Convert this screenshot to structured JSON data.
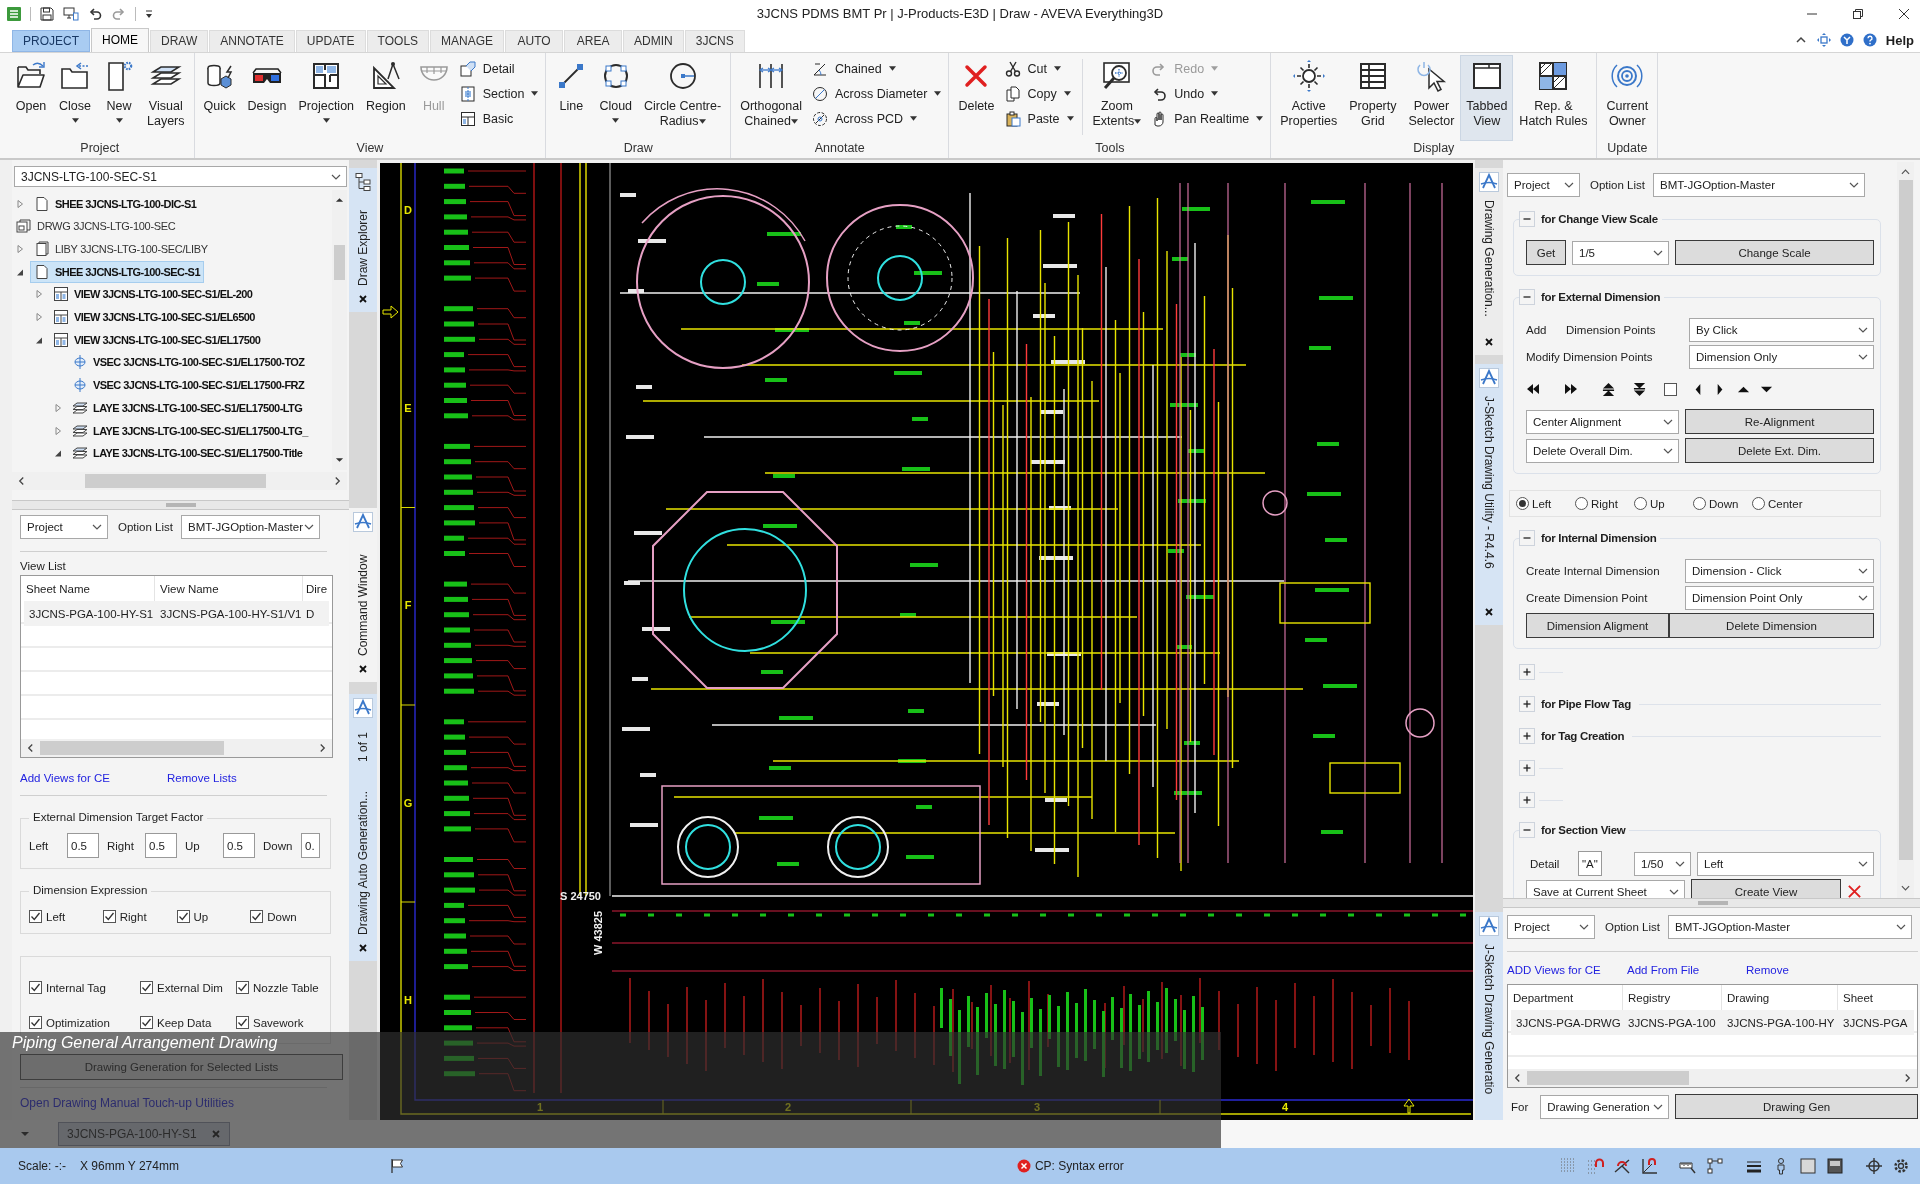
{
  "window": {
    "title": "3JCNS PDMS BMT Pr | J-Products-E3D | Draw - AVEVA Everything3D"
  },
  "ribbon_tabs": [
    {
      "label": "PROJECT",
      "kind": "backstage",
      "selected": false
    },
    {
      "label": "HOME",
      "kind": "tab",
      "selected": true
    },
    {
      "label": "DRAW",
      "kind": "tab",
      "selected": false
    },
    {
      "label": "ANNOTATE",
      "kind": "tab",
      "selected": false
    },
    {
      "label": "UPDATE",
      "kind": "tab",
      "selected": false
    },
    {
      "label": "TOOLS",
      "kind": "tab",
      "selected": false
    },
    {
      "label": "MANAGE",
      "kind": "tab",
      "selected": false
    },
    {
      "label": "AUTO",
      "kind": "tab",
      "selected": false
    },
    {
      "label": "AREA",
      "kind": "tab",
      "selected": false
    },
    {
      "label": "ADMIN",
      "kind": "tab",
      "selected": false
    },
    {
      "label": "3JCNS",
      "kind": "tab",
      "selected": false
    }
  ],
  "help": "Help",
  "ribbon_groups": [
    {
      "label": "Project",
      "items": [
        {
          "kind": "large",
          "label": "Open",
          "dropdown": false
        },
        {
          "kind": "large",
          "label": "Close",
          "dropdown": true
        },
        {
          "kind": "large",
          "label": "New",
          "dropdown": true
        },
        {
          "kind": "large",
          "label": "Visual\nLayers",
          "dropdown": false
        }
      ]
    },
    {
      "label": "View",
      "items": [
        {
          "kind": "large",
          "label": "Quick",
          "dropdown": false,
          "disabled": false
        },
        {
          "kind": "large",
          "label": "Design",
          "dropdown": false,
          "disabled": false
        },
        {
          "kind": "large",
          "label": "Projection",
          "dropdown": true,
          "disabled": false
        },
        {
          "kind": "large",
          "label": "Region",
          "dropdown": false,
          "disabled": false
        },
        {
          "kind": "large",
          "label": "Hull",
          "dropdown": false,
          "disabled": true
        },
        {
          "kind": "stack",
          "items": [
            {
              "label": "Detail",
              "dropdown": false,
              "disabled": false
            },
            {
              "label": "Section",
              "dropdown": true,
              "disabled": false
            },
            {
              "label": "Basic",
              "dropdown": false,
              "disabled": false
            }
          ]
        }
      ]
    },
    {
      "label": "Draw",
      "items": [
        {
          "kind": "large",
          "label": "Line",
          "dropdown": false
        },
        {
          "kind": "large",
          "label": "Cloud",
          "dropdown": true
        },
        {
          "kind": "large",
          "label": "Circle Centre-\nRadius",
          "dropdown": true
        }
      ]
    },
    {
      "label": "Annotate",
      "items": [
        {
          "kind": "large",
          "label": "Orthogonal\nChained",
          "dropdown": true
        },
        {
          "kind": "stack",
          "items": [
            {
              "label": "Chained",
              "dropdown": true
            },
            {
              "label": "Across Diameter",
              "dropdown": true
            },
            {
              "label": "Across PCD",
              "dropdown": true
            }
          ]
        }
      ]
    },
    {
      "label": "Tools",
      "items": [
        {
          "kind": "large",
          "label": "Delete",
          "dropdown": false,
          "disabled": false
        },
        {
          "kind": "stack",
          "items": [
            {
              "label": "Cut",
              "dropdown": true,
              "disabled": false
            },
            {
              "label": "Copy",
              "dropdown": true,
              "disabled": false
            },
            {
              "label": "Paste",
              "dropdown": true,
              "disabled": false
            }
          ]
        },
        {
          "kind": "divider"
        },
        {
          "kind": "large",
          "label": "Zoom\nExtents",
          "dropdown": true,
          "disabled": false
        },
        {
          "kind": "stack",
          "items": [
            {
              "label": "Redo",
              "dropdown": true,
              "disabled": true
            },
            {
              "label": "Undo",
              "dropdown": true,
              "disabled": false
            },
            {
              "label": "Pan Realtime",
              "dropdown": true,
              "disabled": false
            }
          ]
        }
      ]
    },
    {
      "label": "Display",
      "items": [
        {
          "kind": "large",
          "label": "Active\nProperties",
          "dropdown": false,
          "on": false
        },
        {
          "kind": "large",
          "label": "Property\nGrid",
          "dropdown": false,
          "on": false
        },
        {
          "kind": "large",
          "label": "Power\nSelector",
          "dropdown": false,
          "on": false
        },
        {
          "kind": "large",
          "label": "Tabbed\nView",
          "dropdown": false,
          "on": true
        },
        {
          "kind": "large",
          "label": "Rep. &\nHatch Rules",
          "dropdown": false,
          "on": false
        }
      ]
    },
    {
      "label": "Update",
      "items": [
        {
          "kind": "large",
          "label": "Current\nOwner",
          "dropdown": false
        }
      ]
    }
  ],
  "explorer": {
    "selector": "3JCNS-LTG-100-SEC-S1",
    "tree": [
      {
        "kind": "shee",
        "label": "SHEE 3JCNS-LTG-100-DIC-S1",
        "expanded": false,
        "selected": false
      },
      {
        "kind": "drwg",
        "label": "DRWG 3JCNS-LTG-100-SEC",
        "selected": false,
        "children": [
          {
            "kind": "liby",
            "label": "LIBY 3JCNS-LTG-100-SEC/LIBY",
            "expanded": false,
            "selected": false
          },
          {
            "kind": "shee",
            "label": "SHEE 3JCNS-LTG-100-SEC-S1",
            "expanded": true,
            "selected": true,
            "children": [
              {
                "kind": "view",
                "label": "VIEW 3JCNS-LTG-100-SEC-S1/EL-200",
                "expanded": false,
                "selected": false
              },
              {
                "kind": "view",
                "label": "VIEW 3JCNS-LTG-100-SEC-S1/EL6500",
                "expanded": false,
                "selected": false
              },
              {
                "kind": "view",
                "label": "VIEW 3JCNS-LTG-100-SEC-S1/EL17500",
                "expanded": true,
                "selected": false,
                "children": [
                  {
                    "kind": "vsec",
                    "label": "VSEC 3JCNS-LTG-100-SEC-S1/EL17500-TOZ",
                    "selected": false
                  },
                  {
                    "kind": "vsec",
                    "label": "VSEC 3JCNS-LTG-100-SEC-S1/EL17500-FRZ",
                    "selected": false
                  },
                  {
                    "kind": "laye",
                    "label": "LAYE 3JCNS-LTG-100-SEC-S1/EL17500-LTG",
                    "expanded": false,
                    "selected": false
                  },
                  {
                    "kind": "laye",
                    "label": "LAYE 3JCNS-LTG-100-SEC-S1/EL17500-LTG_",
                    "expanded": false,
                    "selected": false
                  },
                  {
                    "kind": "laye",
                    "label": "LAYE 3JCNS-LTG-100-SEC-S1/EL17500-Title",
                    "expanded": true,
                    "selected": false
                  }
                ]
              }
            ]
          }
        ]
      }
    ]
  },
  "left_tabs": [
    {
      "label": "Draw Explorer",
      "selected": true
    },
    {
      "label": "Command Window",
      "selected": false
    },
    {
      "label": "Drawing Auto Generation...",
      "page": "1 of 1",
      "selected": true
    }
  ],
  "auto_generation": {
    "scope": "Project",
    "option_label": "Option List",
    "option": "BMT-JGOption-Master",
    "list_label": "View List",
    "columns": [
      "Sheet Name",
      "View Name",
      "Dire"
    ],
    "rows": [
      [
        "3JCNS-PGA-100-HY-S1",
        "3JCNS-PGA-100-HY-S1/V1",
        "D"
      ]
    ],
    "links": [
      "Add Views for CE",
      "Remove Lists"
    ],
    "factor_title": "External Dimension Target Factor",
    "factors": [
      {
        "label": "Left",
        "value": "0.5"
      },
      {
        "label": "Right",
        "value": "0.5"
      },
      {
        "label": "Up",
        "value": "0.5"
      },
      {
        "label": "Down",
        "value": "0."
      }
    ],
    "expression_title": "Dimension Expression",
    "expressions": [
      {
        "label": "Left",
        "checked": true
      },
      {
        "label": "Right",
        "checked": true
      },
      {
        "label": "Up",
        "checked": true
      },
      {
        "label": "Down",
        "checked": true
      }
    ],
    "options": [
      {
        "label": "Internal Tag",
        "checked": true
      },
      {
        "label": "External Dim",
        "checked": true
      },
      {
        "label": "Nozzle Table",
        "checked": true
      },
      {
        "label": "Optimization",
        "checked": true
      },
      {
        "label": "Keep Data",
        "checked": true
      },
      {
        "label": "Savework",
        "checked": true
      }
    ],
    "generate_button": "Drawing Generation for Selected Lists",
    "touchup_link": "Open Drawing Manual Touch-up Utilities"
  },
  "document_tabs": [
    {
      "label": "3JCNS-PGA-100-HY-S1",
      "selected": true
    }
  ],
  "caption": "Piping General Arrangement Drawing",
  "canvas": {
    "row_labels": [
      "D",
      "E",
      "F",
      "G",
      "H"
    ],
    "column_labels": [
      "1",
      "2",
      "3",
      "4"
    ],
    "labels": [
      {
        "text": "S 24750",
        "kind": "horizontal"
      },
      {
        "text": "W 43825",
        "kind": "vertical"
      }
    ]
  },
  "right_tabs": [
    {
      "label": "Drawing Generation...",
      "selected": false
    },
    {
      "label": "J-Sketch Drawing Utility - R4.4.6",
      "selected": true
    },
    {
      "label": "J-Sketch Drawing Generatio",
      "selected": true
    }
  ],
  "sketch_utility": {
    "scope": "Project",
    "option_label": "Option List",
    "option": "BMT-JGOption-Master",
    "sections": [
      {
        "kind": "scale",
        "title": "for Change View Scale",
        "expanded": true,
        "get_button": "Get",
        "scale": "1/5",
        "apply_button": "Change Scale"
      },
      {
        "kind": "external",
        "title": "for External Dimension",
        "expanded": true,
        "add_label": "Add",
        "points_label": "Dimension Points",
        "add_mode": "By Click",
        "modify_label": "Modify Dimension Points",
        "modify_mode": "Dimension Only",
        "marker_checked": false,
        "alignment": "Center Alignment",
        "realign_button": "Re-Alignment",
        "delete_mode": "Delete Overall Dim.",
        "delete_button": "Delete Ext. Dim."
      },
      {
        "kind": "radios",
        "options": [
          {
            "label": "Left",
            "selected": true
          },
          {
            "label": "Right",
            "selected": false
          },
          {
            "label": "Up",
            "selected": false
          },
          {
            "label": "Down",
            "selected": false
          },
          {
            "label": "Center",
            "selected": false
          }
        ]
      },
      {
        "kind": "internal",
        "title": "for Internal Dimension",
        "expanded": true,
        "create_label": "Create Internal Dimension",
        "create_mode": "Dimension - Click",
        "point_label": "Create Dimension Point",
        "point_mode": "Dimension Point Only",
        "buttons": [
          "Dimension Aligment",
          "Delete Dimension"
        ]
      },
      {
        "kind": "collapsed",
        "expanded": false
      },
      {
        "kind": "collapsed",
        "title": "for Pipe Flow Tag",
        "expanded": false
      },
      {
        "kind": "collapsed",
        "title": "for Tag Creation",
        "expanded": false
      },
      {
        "kind": "collapsed",
        "expanded": false
      },
      {
        "kind": "collapsed",
        "expanded": false
      },
      {
        "kind": "section_view",
        "title": "for Section View",
        "expanded": true,
        "detail_label": "Detail",
        "detail": "\"A\"",
        "scale": "1/50",
        "side": "Left",
        "save_mode": "Save at Current Sheet",
        "create_button": "Create View"
      }
    ]
  },
  "drawing_generation": {
    "scope": "Project",
    "option_label": "Option List",
    "option": "BMT-JGOption-Master",
    "links": [
      "ADD Views for CE",
      "Add From File",
      "Remove"
    ],
    "columns": [
      "Department",
      "Registry",
      "Drawing",
      "Sheet"
    ],
    "rows": [
      [
        "3JCNS-PGA-DRWG",
        "3JCNS-PGA-100",
        "3JCNS-PGA-100-HY",
        "3JCNS-PGA"
      ]
    ],
    "for_label": "For",
    "for_mode": "Drawing Generation",
    "generate_button": "Drawing Gen"
  },
  "status_bar": {
    "scale": "Scale: -:-",
    "position": "X 96mm Y 274mm",
    "message": "CP: Syntax error"
  }
}
